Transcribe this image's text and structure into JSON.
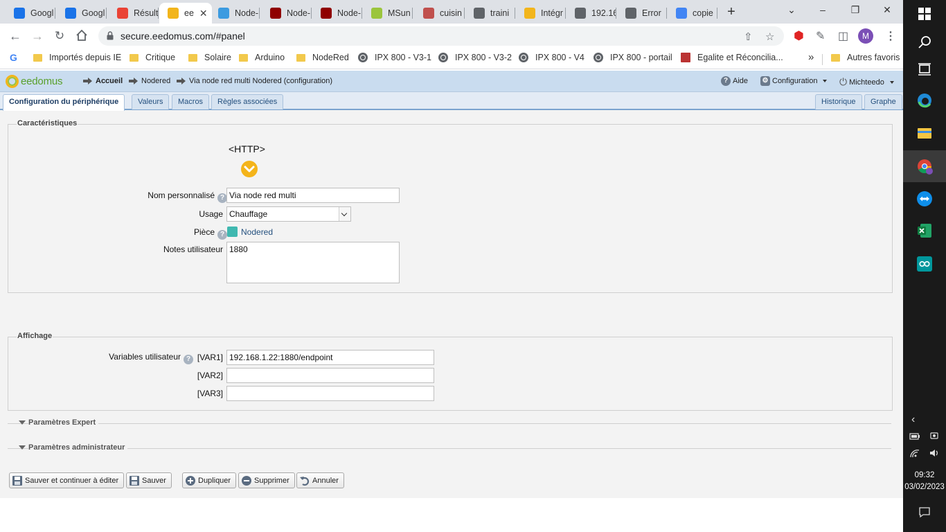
{
  "browser": {
    "tabs": [
      {
        "label": "Googl",
        "icon": "google-account-icon",
        "color": "#1a73e8"
      },
      {
        "label": "Googl",
        "icon": "google-calendar-icon",
        "color": "#1a73e8"
      },
      {
        "label": "Résult",
        "icon": "gmail-icon",
        "color": "#ea4335"
      },
      {
        "label": "ee",
        "icon": "eedomus-icon",
        "color": "#f2b51c",
        "active": true
      },
      {
        "label": "Node-",
        "icon": "home-icon",
        "color": "#3c9be0"
      },
      {
        "label": "Node-",
        "icon": "node-red-icon",
        "color": "#8f0000"
      },
      {
        "label": "Node-",
        "icon": "node-red-icon",
        "color": "#8f0000"
      },
      {
        "label": "MSun",
        "icon": "msunpv-icon",
        "color": "#9bc53d"
      },
      {
        "label": "cuisin",
        "icon": "cuisine-icon",
        "color": "#c0504d"
      },
      {
        "label": "traini",
        "icon": "globe-icon",
        "color": "#5f6368"
      },
      {
        "label": "Intégr",
        "icon": "q-icon",
        "color": "#f2b51c"
      },
      {
        "label": "192.16",
        "icon": "globe-icon",
        "color": "#5f6368"
      },
      {
        "label": "Error",
        "icon": "globe-icon",
        "color": "#5f6368"
      },
      {
        "label": "copie",
        "icon": "google-icon",
        "color": "#4285f4"
      }
    ],
    "url": "secure.eedomus.com/#panel",
    "avatar_letter": "M",
    "bookmarks": [
      {
        "label": "Importés depuis IE",
        "icon": "folder-icon"
      },
      {
        "label": "Critique",
        "icon": "folder-icon"
      },
      {
        "label": "Solaire",
        "icon": "folder-icon"
      },
      {
        "label": "Arduino",
        "icon": "folder-icon"
      },
      {
        "label": "NodeRed",
        "icon": "folder-icon"
      },
      {
        "label": "IPX 800 - V3-1",
        "icon": "globe-icon"
      },
      {
        "label": "IPX 800 - V3-2",
        "icon": "globe-icon"
      },
      {
        "label": "IPX 800 - V4",
        "icon": "globe-icon"
      },
      {
        "label": "IPX 800 - portail",
        "icon": "globe-icon"
      },
      {
        "label": "Egalite et Réconcilia...",
        "icon": "site-icon"
      }
    ],
    "bookmarks_overflow": "»",
    "other_bookmarks": "Autres favoris"
  },
  "app": {
    "logo_text": "eedomus",
    "breadcrumb": [
      "Accueil",
      "Nodered",
      "Via node red multi Nodered (configuration)"
    ],
    "header_right": {
      "help": "Aide",
      "config": "Configuration",
      "user": "Michteedo"
    },
    "tabs": [
      "Configuration du périphérique",
      "Valeurs",
      "Macros",
      "Règles associées"
    ],
    "tabs_right": [
      "Historique",
      "Graphe"
    ],
    "characteristics": {
      "legend": "Caractéristiques",
      "device_type": "<HTTP>",
      "name_label": "Nom personnalisé",
      "name_value": "Via node red multi",
      "usage_label": "Usage",
      "usage_value": "Chauffage",
      "room_label": "Pièce",
      "room_value": "Nodered",
      "room_color": "#3fb8b0",
      "notes_label": "Notes utilisateur",
      "notes_value": "1880"
    },
    "display": {
      "legend": "Affichage",
      "vars_label": "Variables utilisateur",
      "var1_label": "[VAR1]",
      "var1_value": "192.168.1.22:1880/endpoint",
      "var2_label": "[VAR2]",
      "var2_value": "",
      "var3_label": "[VAR3]",
      "var3_value": ""
    },
    "expert": "Paramètres Expert",
    "admin": "Paramètres administrateur",
    "buttons": {
      "save_continue": "Sauver et continuer à éditer",
      "save": "Sauver",
      "duplicate": "Dupliquer",
      "delete": "Supprimer",
      "cancel": "Annuler"
    }
  },
  "taskbar": {
    "time": "09:32",
    "date": "03/02/2023"
  }
}
